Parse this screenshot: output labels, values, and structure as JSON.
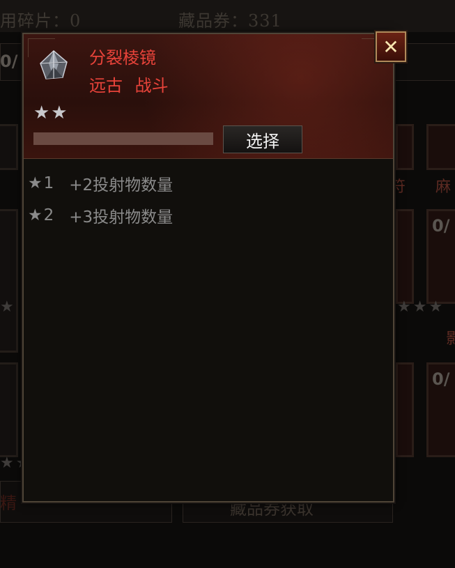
{
  "background": {
    "fragments_text": "用碎片：0",
    "voucher_text": "藏品券：331",
    "left_count": "0/",
    "right_count_1": "0/",
    "right_count_2": "0/",
    "right_red_text": "麻",
    "right_red_text_2": "符",
    "right_red_text_3": "影",
    "bottom_left": "精",
    "bottom_right": "藏品券获取"
  },
  "popup": {
    "item_name": "分裂棱镜",
    "tags": [
      "远古",
      "战斗"
    ],
    "star_count": 2,
    "stars_display": "★★",
    "progress_fraction": 0,
    "select_label": "选择",
    "effects": [
      {
        "star": "★",
        "level": "1",
        "text": "+2投射物数量"
      },
      {
        "star": "★",
        "level": "2",
        "text": "+3投射物数量"
      }
    ],
    "close_label": "✕"
  },
  "colors": {
    "accent_red": "#e8433a",
    "header_bg": "#2a0f0b",
    "body_bg": "#110f0c",
    "effect_text": "#8a8a8a"
  },
  "icons": {
    "item": "prism-crystal-icon",
    "close": "close-icon",
    "star": "star-icon"
  }
}
